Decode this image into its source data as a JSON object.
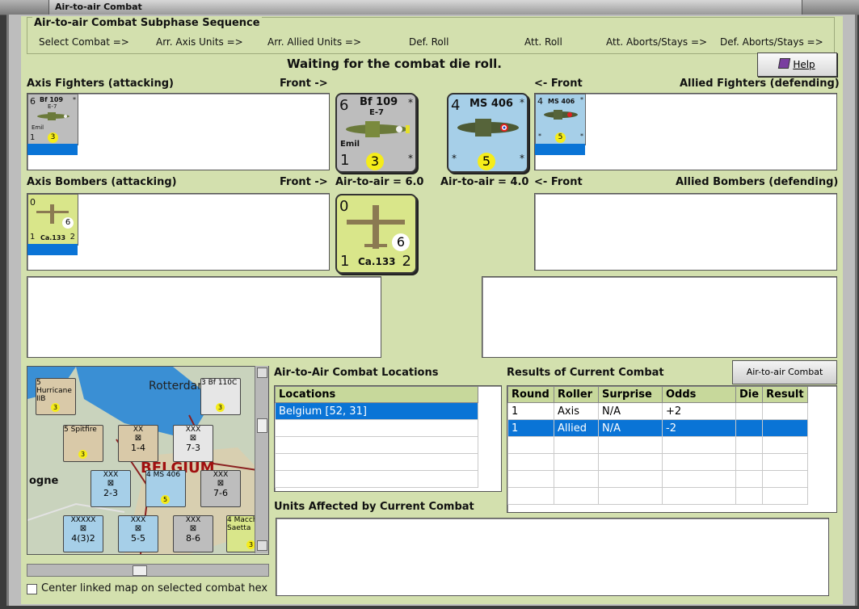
{
  "window": {
    "title": "Air-to-air Combat"
  },
  "sequence": {
    "heading": "Air-to-air Combat Subphase Sequence",
    "steps": [
      "Select Combat =>",
      "Arr. Axis Units =>",
      "Arr. Allied Units =>",
      "Def. Roll",
      "Att. Roll",
      "Att. Aborts/Stays =>",
      "Def. Aborts/Stays =>"
    ]
  },
  "status": "Waiting for the combat die roll.",
  "help_label": "Help",
  "axis_fighters": {
    "label": "Axis Fighters (attacking)",
    "front": "Front ->"
  },
  "allied_fighters": {
    "label": "Allied Fighters (defending)",
    "front": "<- Front"
  },
  "axis_bombers": {
    "label": "Axis Bombers (attacking)",
    "front": "Front ->"
  },
  "allied_bombers": {
    "label": "Allied Bombers (defending)",
    "front": "<- Front"
  },
  "axis_air_to_air": "Air-to-air = 6.0",
  "allied_air_to_air": "Air-to-air = 4.0",
  "counters": {
    "bf109": {
      "top_left": "6",
      "name": "Bf 109",
      "variant": "E-7",
      "nickname": "Emil",
      "bottom_left": "1",
      "circle": "3",
      "star": "*",
      "color": "#bdbdbd"
    },
    "ms406": {
      "top_left": "4",
      "name": "MS 406",
      "bottom_left": "*",
      "circle": "5",
      "star": "*",
      "color": "#a6cfe8"
    },
    "ca133": {
      "top_left": "0",
      "name": "Ca.133",
      "bottom_left": "1",
      "bottom_right": "2",
      "circle": "6",
      "color": "#d9e68a"
    }
  },
  "locations": {
    "title": "Air-to-Air Combat Locations",
    "column": "Locations",
    "rows": [
      "Belgium [52, 31]"
    ]
  },
  "results": {
    "title": "Results of Current Combat",
    "chart_button": "Air-to-air Combat Chart",
    "columns": [
      "Round",
      "Roller",
      "Surprise",
      "Odds",
      "Die",
      "Result"
    ],
    "rows": [
      [
        "1",
        "Axis",
        "N/A",
        "+2",
        "",
        ""
      ],
      [
        "1",
        "Allied",
        "N/A",
        "-2",
        "",
        ""
      ]
    ]
  },
  "units_affected": {
    "title": "Units Affected by Current Combat"
  },
  "map": {
    "labels": [
      "Rotterdam",
      "BELGIUM",
      "ogne"
    ],
    "hexes": [
      {
        "name": "Hurricane",
        "sub": "IIB",
        "tl": "5",
        "c": "3",
        "color": "#d9c9a8"
      },
      {
        "name": "Spitfire",
        "tl": "5",
        "c": "3",
        "color": "#d9c9a8"
      },
      {
        "name": "Bf 110C",
        "tl": "3",
        "c": "3",
        "color": "#e6e6e6"
      },
      {
        "name": "1-4",
        "top": "XX",
        "color": "#d9c9a8"
      },
      {
        "name": "7-3",
        "top": "XXX",
        "color": "#e6e6e6"
      },
      {
        "name": "2-3",
        "top": "XXX",
        "color": "#a6cfe8"
      },
      {
        "name": "MS 406",
        "tl": "4",
        "c": "5",
        "color": "#a6cfe8"
      },
      {
        "name": "7-6",
        "top": "XXX",
        "color": "#bdbdbd"
      },
      {
        "name": "4(3)2",
        "top": "XXXXX",
        "color": "#a6cfe8"
      },
      {
        "name": "5-5",
        "top": "XXX",
        "color": "#a6cfe8"
      },
      {
        "name": "8-6",
        "top": "XXX",
        "color": "#bdbdbd"
      },
      {
        "name": "Macchi",
        "sub": "Saetta",
        "tl": "4",
        "c": "3",
        "color": "#d9e68a"
      }
    ]
  },
  "center_checkbox": "Center linked map on selected combat hex"
}
